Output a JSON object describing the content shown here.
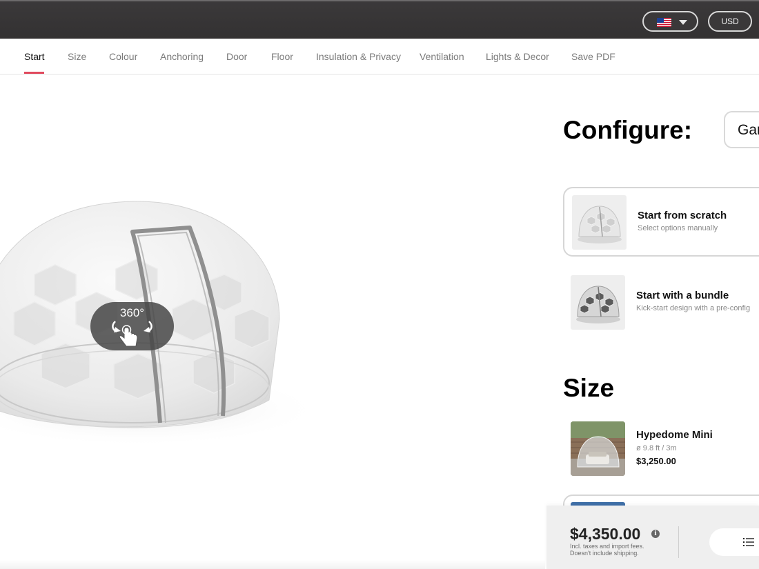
{
  "header": {
    "country_flag_icon": "us-flag-icon",
    "country_dropdown_icon": "chevron-down-icon",
    "currency": "USD"
  },
  "nav": {
    "tabs": [
      {
        "label": "Start",
        "active": true
      },
      {
        "label": "Size",
        "active": false
      },
      {
        "label": "Colour",
        "active": false
      },
      {
        "label": "Anchoring",
        "active": false
      },
      {
        "label": "Door",
        "active": false
      },
      {
        "label": "Floor",
        "active": false
      },
      {
        "label": "Insulation & Privacy",
        "active": false
      },
      {
        "label": "Ventilation",
        "active": false
      },
      {
        "label": "Lights & Decor",
        "active": false
      },
      {
        "label": "Save PDF",
        "active": false
      }
    ],
    "accent_color": "#e0495d"
  },
  "viewer": {
    "rotate_label": "360°",
    "rotate_icon": "hand-rotate-360-icon"
  },
  "configure": {
    "title": "Configure:",
    "type_select_value": "Gar",
    "options": [
      {
        "title": "Start from scratch",
        "subtitle": "Select options manually",
        "selected": true
      },
      {
        "title": "Start with a bundle",
        "subtitle": "Kick-start design with a pre-config",
        "selected": false
      }
    ]
  },
  "size": {
    "title": "Size",
    "items": [
      {
        "name": "Hypedome Mini",
        "dimension": "ø 9.8 ft / 3m",
        "price": "$3,250.00"
      }
    ]
  },
  "footer": {
    "price": "$4,350.00",
    "info_icon": "info-icon",
    "note_line1": "Incl. taxes and import fees.",
    "note_line2": "Doesn't include shipping.",
    "summary_icon": "list-icon"
  }
}
